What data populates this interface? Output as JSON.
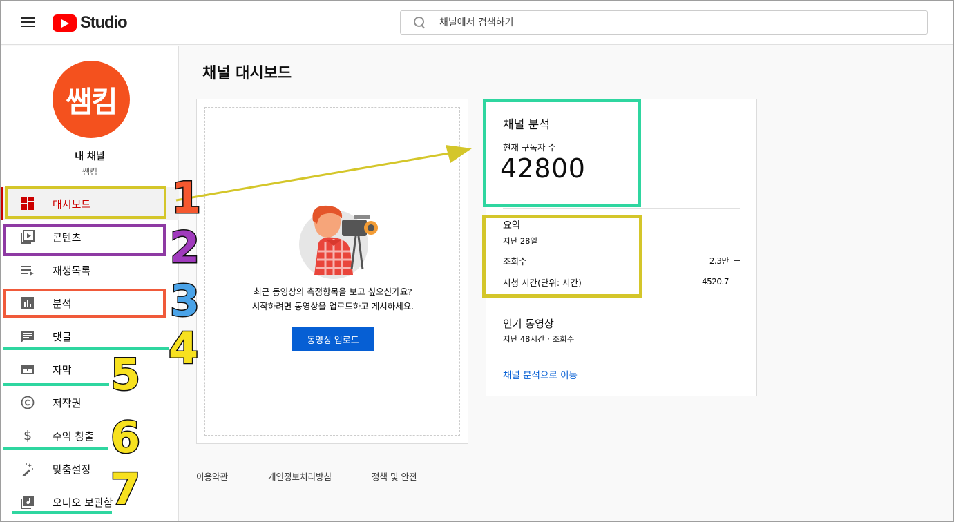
{
  "header": {
    "logo_text": "Studio",
    "search_placeholder": "채널에서 검색하기"
  },
  "sidebar": {
    "avatar_text": "쌤킴",
    "channel_title": "내 채널",
    "channel_name": "쌤킴",
    "items": [
      {
        "label": "대시보드",
        "icon": "dashboard-icon",
        "active": true
      },
      {
        "label": "콘텐츠",
        "icon": "content-icon"
      },
      {
        "label": "재생목록",
        "icon": "playlist-icon"
      },
      {
        "label": "분석",
        "icon": "analytics-icon"
      },
      {
        "label": "댓글",
        "icon": "comments-icon"
      },
      {
        "label": "자막",
        "icon": "subtitles-icon"
      },
      {
        "label": "저작권",
        "icon": "copyright-icon"
      },
      {
        "label": "수익 창출",
        "icon": "dollar-icon"
      },
      {
        "label": "맞춤설정",
        "icon": "magic-wand-icon"
      },
      {
        "label": "오디오 보관함",
        "icon": "audio-library-icon"
      }
    ]
  },
  "main": {
    "title": "채널 대시보드",
    "upload_card": {
      "line1": "최근 동영상의 측정항목을 보고 싶으신가요?",
      "line2": "시작하려면 동영상을 업로드하고 게시하세요.",
      "button": "동영상 업로드"
    },
    "analytics_card": {
      "title": "채널 분석",
      "subs_label": "현재 구독자 수",
      "subs_value": "42800",
      "summary_title": "요약",
      "summary_period": "지난 28일",
      "metrics": [
        {
          "label": "조회수",
          "value": "2.3만"
        },
        {
          "label": "시청 시간(단위: 시간)",
          "value": "4520.7"
        }
      ],
      "popular_title": "인기 동영상",
      "popular_sub": "지난 48시간 · 조회수",
      "link": "채널 분석으로 이동"
    },
    "footer": [
      "이용약관",
      "개인정보처리방침",
      "정책 및 안전"
    ]
  },
  "annotations": {
    "numbers": [
      "1",
      "2",
      "3",
      "4",
      "5",
      "6",
      "7"
    ],
    "colors": {
      "yellow": "#d4c62a",
      "purple": "#8e3aa3",
      "red": "#f05a3a",
      "teal": "#2fd6a0",
      "num_red": "#f5582f",
      "num_purple": "#a03bbd",
      "num_blue": "#4aa3e8",
      "num_yellow": "#f7e11f"
    }
  }
}
